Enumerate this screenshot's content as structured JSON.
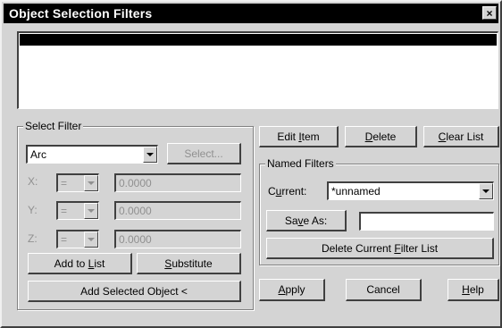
{
  "window": {
    "title": "Object Selection Filters",
    "close_glyph": "×"
  },
  "select_filter": {
    "group_label": "Select Filter",
    "type_value": "Arc",
    "select_button": "Select...",
    "x_label": "X:",
    "y_label": "Y:",
    "z_label": "Z:",
    "x_op": "=",
    "y_op": "=",
    "z_op": "=",
    "x_value": "0.0000",
    "y_value": "0.0000",
    "z_value": "0.0000",
    "add_to_list_pre": "Add to ",
    "add_to_list_key": "L",
    "add_to_list_post": "ist",
    "substitute_key": "S",
    "substitute_post": "ubstitute",
    "add_selected_object": "Add Selected Object <"
  },
  "list_buttons": {
    "edit_item_pre": "Edit ",
    "edit_item_key": "I",
    "edit_item_post": "tem",
    "delete_key": "D",
    "delete_post": "elete",
    "clear_list_key": "C",
    "clear_list_post": "lear List"
  },
  "named_filters": {
    "group_label": "Named Filters",
    "current_label_pre": "C",
    "current_label_key": "u",
    "current_label_post": "rrent:",
    "current_value": "*unnamed",
    "save_as_pre": "Sa",
    "save_as_key": "v",
    "save_as_post": "e As:",
    "save_as_value": "",
    "delete_current_pre": "Delete Current ",
    "delete_current_key": "F",
    "delete_current_post": "ilter List"
  },
  "footer": {
    "apply_key": "A",
    "apply_post": "pply",
    "cancel": "Cancel",
    "help_key": "H",
    "help_post": "elp"
  },
  "colors": {
    "face": "#d4d4d4",
    "title_bg": "#000000",
    "selected_row": "#000000"
  }
}
